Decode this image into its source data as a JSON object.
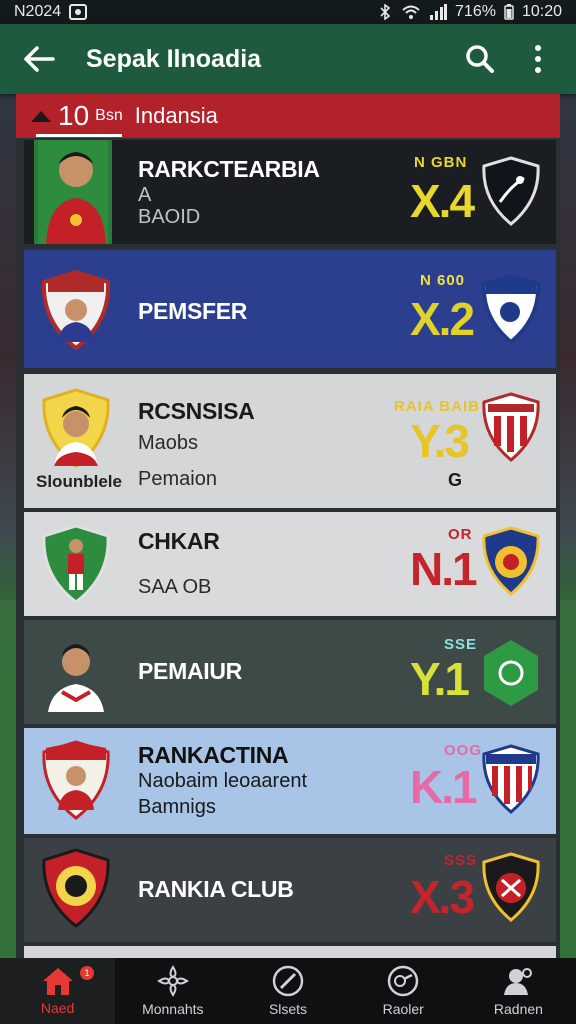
{
  "status_bar": {
    "left_text": "N2024",
    "battery": "716%",
    "time": "10:20"
  },
  "app_bar": {
    "title": "Sepak Ilnoadia"
  },
  "list_header": {
    "rank": "10",
    "sub": "Bsn",
    "title": "Indansia"
  },
  "rows": [
    {
      "name": "RARKCTEARBIA",
      "line1": "A",
      "line2": "BAOID",
      "tag": "N GBN",
      "score": "X.4",
      "bg": "#1a1d21",
      "score_color": "#e8d82c"
    },
    {
      "name": "PEMSFER",
      "tag": "N 600",
      "score": "X.2",
      "bg": "#2c3f8f",
      "score_color": "#e0d22a"
    },
    {
      "name": "RCSNSISA",
      "line1": "Maobs",
      "line2": "Pemaion",
      "sublabel": "Slounblele",
      "tag": "RAIA BAIB",
      "score": "Y.3",
      "extra": "G",
      "bg": "#d4d6d8",
      "score_color": "#e6c52a"
    },
    {
      "name": "CHKAR",
      "line2": "SAA OB",
      "tag": "OR",
      "score": "N.1",
      "bg": "#d8dadb",
      "score_color": "#c4242c"
    },
    {
      "name": "PEMAIUR",
      "tag": "SSE",
      "score": "Y.1",
      "bg": "#3e4a47",
      "score_color": "#d8e03a"
    },
    {
      "name": "RANKACTINA",
      "line1": "Naobaim leoaarent",
      "line2": "Bamnigs",
      "tag": "OOG",
      "score": "K.1",
      "bg": "#a8c4e6",
      "score_color": "#e66aa8"
    },
    {
      "name": "RANKIA CLUB",
      "tag": "SSS",
      "score": "X.3",
      "bg": "#3a4043",
      "score_color": "#c4242c"
    }
  ],
  "bottom_nav": {
    "items": [
      {
        "label": "Naed",
        "icon": "home-icon"
      },
      {
        "label": "Monnahts",
        "icon": "flower-icon"
      },
      {
        "label": "Slsets",
        "icon": "compass-icon"
      },
      {
        "label": "Raoler",
        "icon": "whistle-icon"
      },
      {
        "label": "Radnen",
        "icon": "user-icon"
      }
    ],
    "badge": "1"
  }
}
